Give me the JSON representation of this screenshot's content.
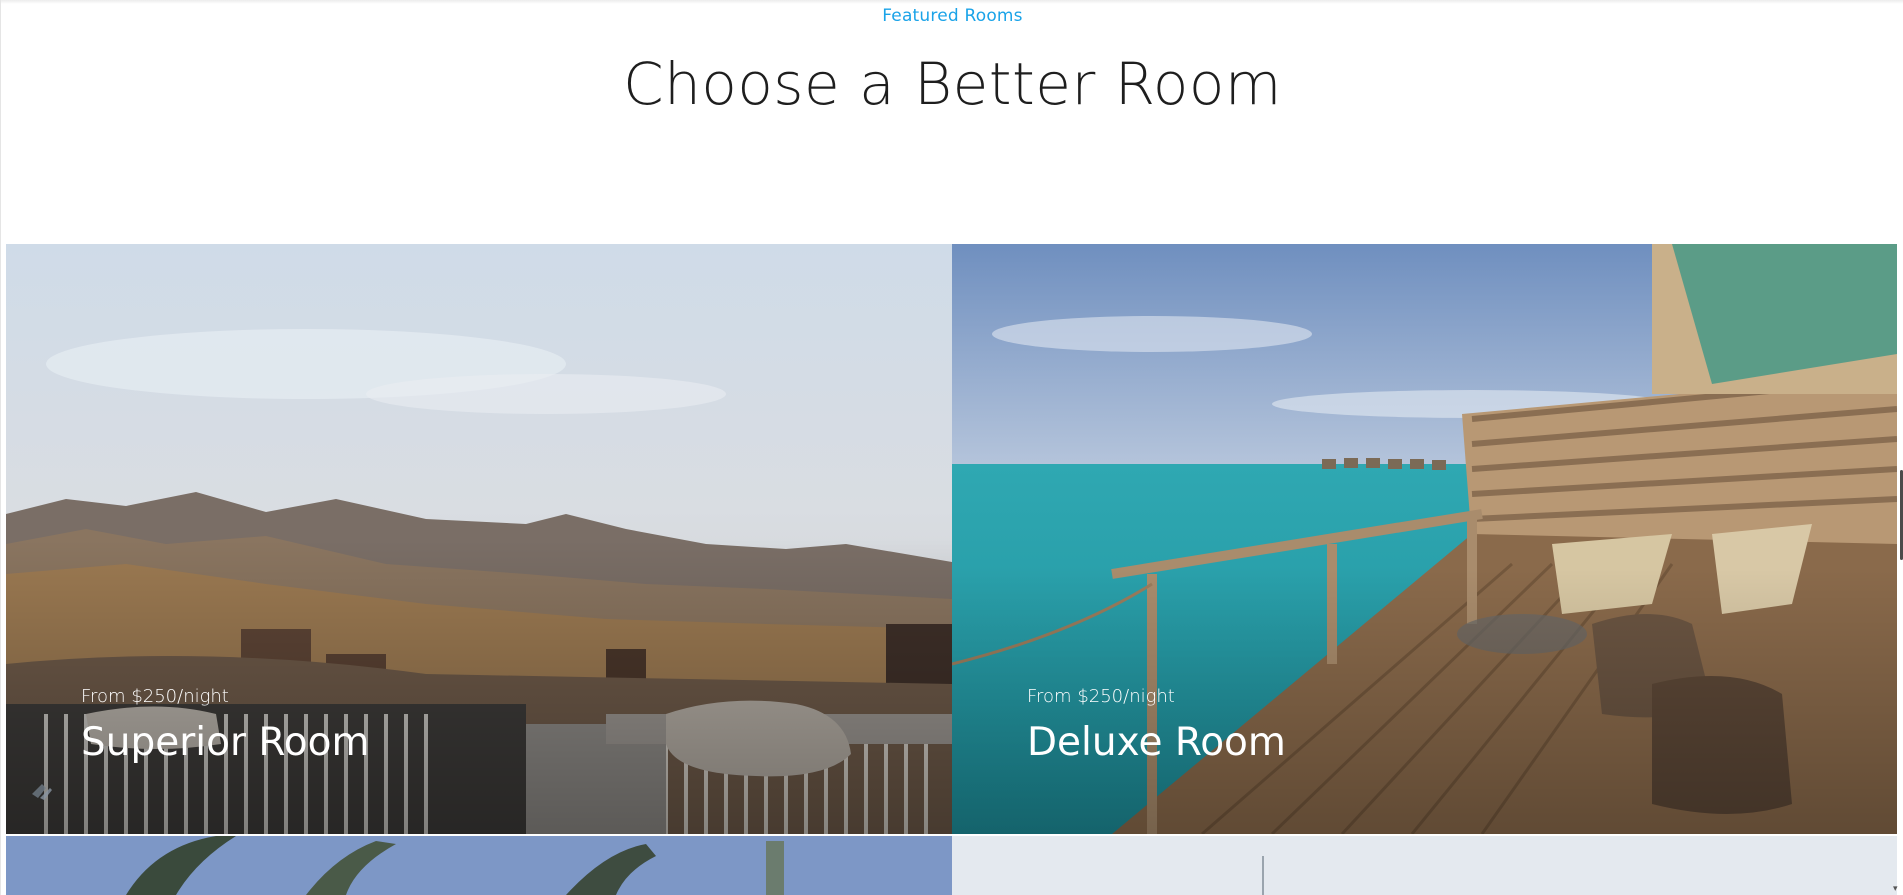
{
  "section": {
    "eyebrow": "Featured Rooms",
    "title": "Choose a Better Room"
  },
  "rooms": [
    {
      "price": "From $250/night",
      "name": "Superior Room",
      "scene": "mountain-desert-terrace"
    },
    {
      "price": "From $250/night",
      "name": "Deluxe Room",
      "scene": "ocean-deck-villa"
    },
    {
      "price": "",
      "name": "",
      "scene": "palm-sky"
    },
    {
      "price": "",
      "name": "",
      "scene": "pale-sky"
    }
  ],
  "colors": {
    "accent": "#1aa3e8",
    "title": "#1e1e1e",
    "card_text": "#ffffff"
  }
}
